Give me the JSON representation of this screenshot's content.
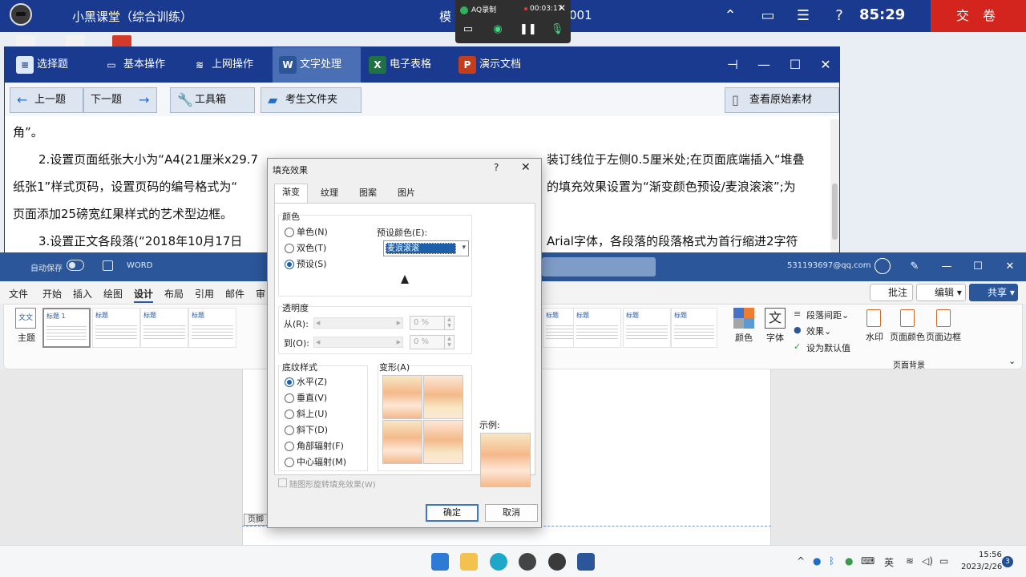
{
  "exam_bar": {
    "app_title": "小黑课堂（综合训练）",
    "exam_name_prefix": "模",
    "exam_name_suffix": "001",
    "timer": "85:29",
    "submit_label": "交 卷"
  },
  "recorder": {
    "name": "AQ录制",
    "elapsed": "00:03:17"
  },
  "exam_tabs": [
    {
      "label": "选择题"
    },
    {
      "label": "基本操作"
    },
    {
      "label": "上网操作"
    },
    {
      "label": "文字处理"
    },
    {
      "label": "电子表格"
    },
    {
      "label": "演示文档"
    }
  ],
  "exam_toolbar": {
    "prev": "上一题",
    "next": "下一题",
    "tools": "工具箱",
    "folder": "考生文件夹",
    "view_source": "查看原始素材"
  },
  "question_lines": [
    "角”。",
    "2.设置页面纸张大小为“A4(21厘米x29.7",
    "装订线位于左侧0.5厘米处;在页面底端插入“堆叠",
    "纸张1”样式页码，设置页码的编号格式为“",
    "的填充效果设置为“渐变颜色预设/麦浪滚滚”;为",
    "页面添加25磅宽红果样式的艺术型边框。",
    "3.设置正文各段落(“2018年10月17日",
    "Arial字体，各段落的段落格式为首行缩进2字符"
  ],
  "word": {
    "autosave": "自动保存",
    "doc_name": "WORD",
    "account": "531193697@qq.com",
    "menu": [
      "文件",
      "开始",
      "插入",
      "绘图",
      "设计",
      "布局",
      "引用",
      "邮件",
      "审"
    ],
    "active_menu": "设计",
    "comment_btn": "批注",
    "edit_btn": "编辑",
    "share_btn": "共享",
    "theme_label": "主题",
    "style_thumbs": [
      "标题 1",
      "标题",
      "标题",
      "标题",
      "标题",
      "标题",
      "标题",
      "标题"
    ],
    "colors_label": "颜色",
    "fonts_label": "字体",
    "para_spacing": "段落间距",
    "effects": "效果",
    "set_default": "设为默认值",
    "watermark": "水印",
    "page_color": "页面颜色",
    "page_border": "页面边框",
    "page_bg_group": "页面背景",
    "footer_tag": "页脚"
  },
  "dialog": {
    "title": "填充效果",
    "help": "?",
    "tabs": [
      "渐变",
      "纹理",
      "图案",
      "图片"
    ],
    "active_tab": "渐变",
    "colors_group": "颜色",
    "color_options": [
      "单色(N)",
      "双色(T)",
      "预设(S)"
    ],
    "color_selected": "预设(S)",
    "preset_label": "预设颜色(E):",
    "preset_value": "麦浪滚滚",
    "transparency_group": "透明度",
    "from_label": "从(R):",
    "to_label": "到(O):",
    "from_value": "0 %",
    "to_value": "0 %",
    "shading_group": "底纹样式",
    "shading_options": [
      "水平(Z)",
      "垂直(V)",
      "斜上(U)",
      "斜下(D)",
      "角部辐射(F)",
      "中心辐射(M)"
    ],
    "shading_selected": "水平(Z)",
    "variants_label": "变形(A)",
    "sample_label": "示例:",
    "rotate_checkbox": "随图形旋转填充效果(W)",
    "ok": "确定",
    "cancel": "取消",
    "gradient_colors": [
      "#f7e7c4",
      "#f4b98a",
      "#fde7d6"
    ]
  },
  "taskbar": {
    "ime": "英",
    "time": "15:56",
    "date": "2023/2/26",
    "notifications": "3"
  }
}
